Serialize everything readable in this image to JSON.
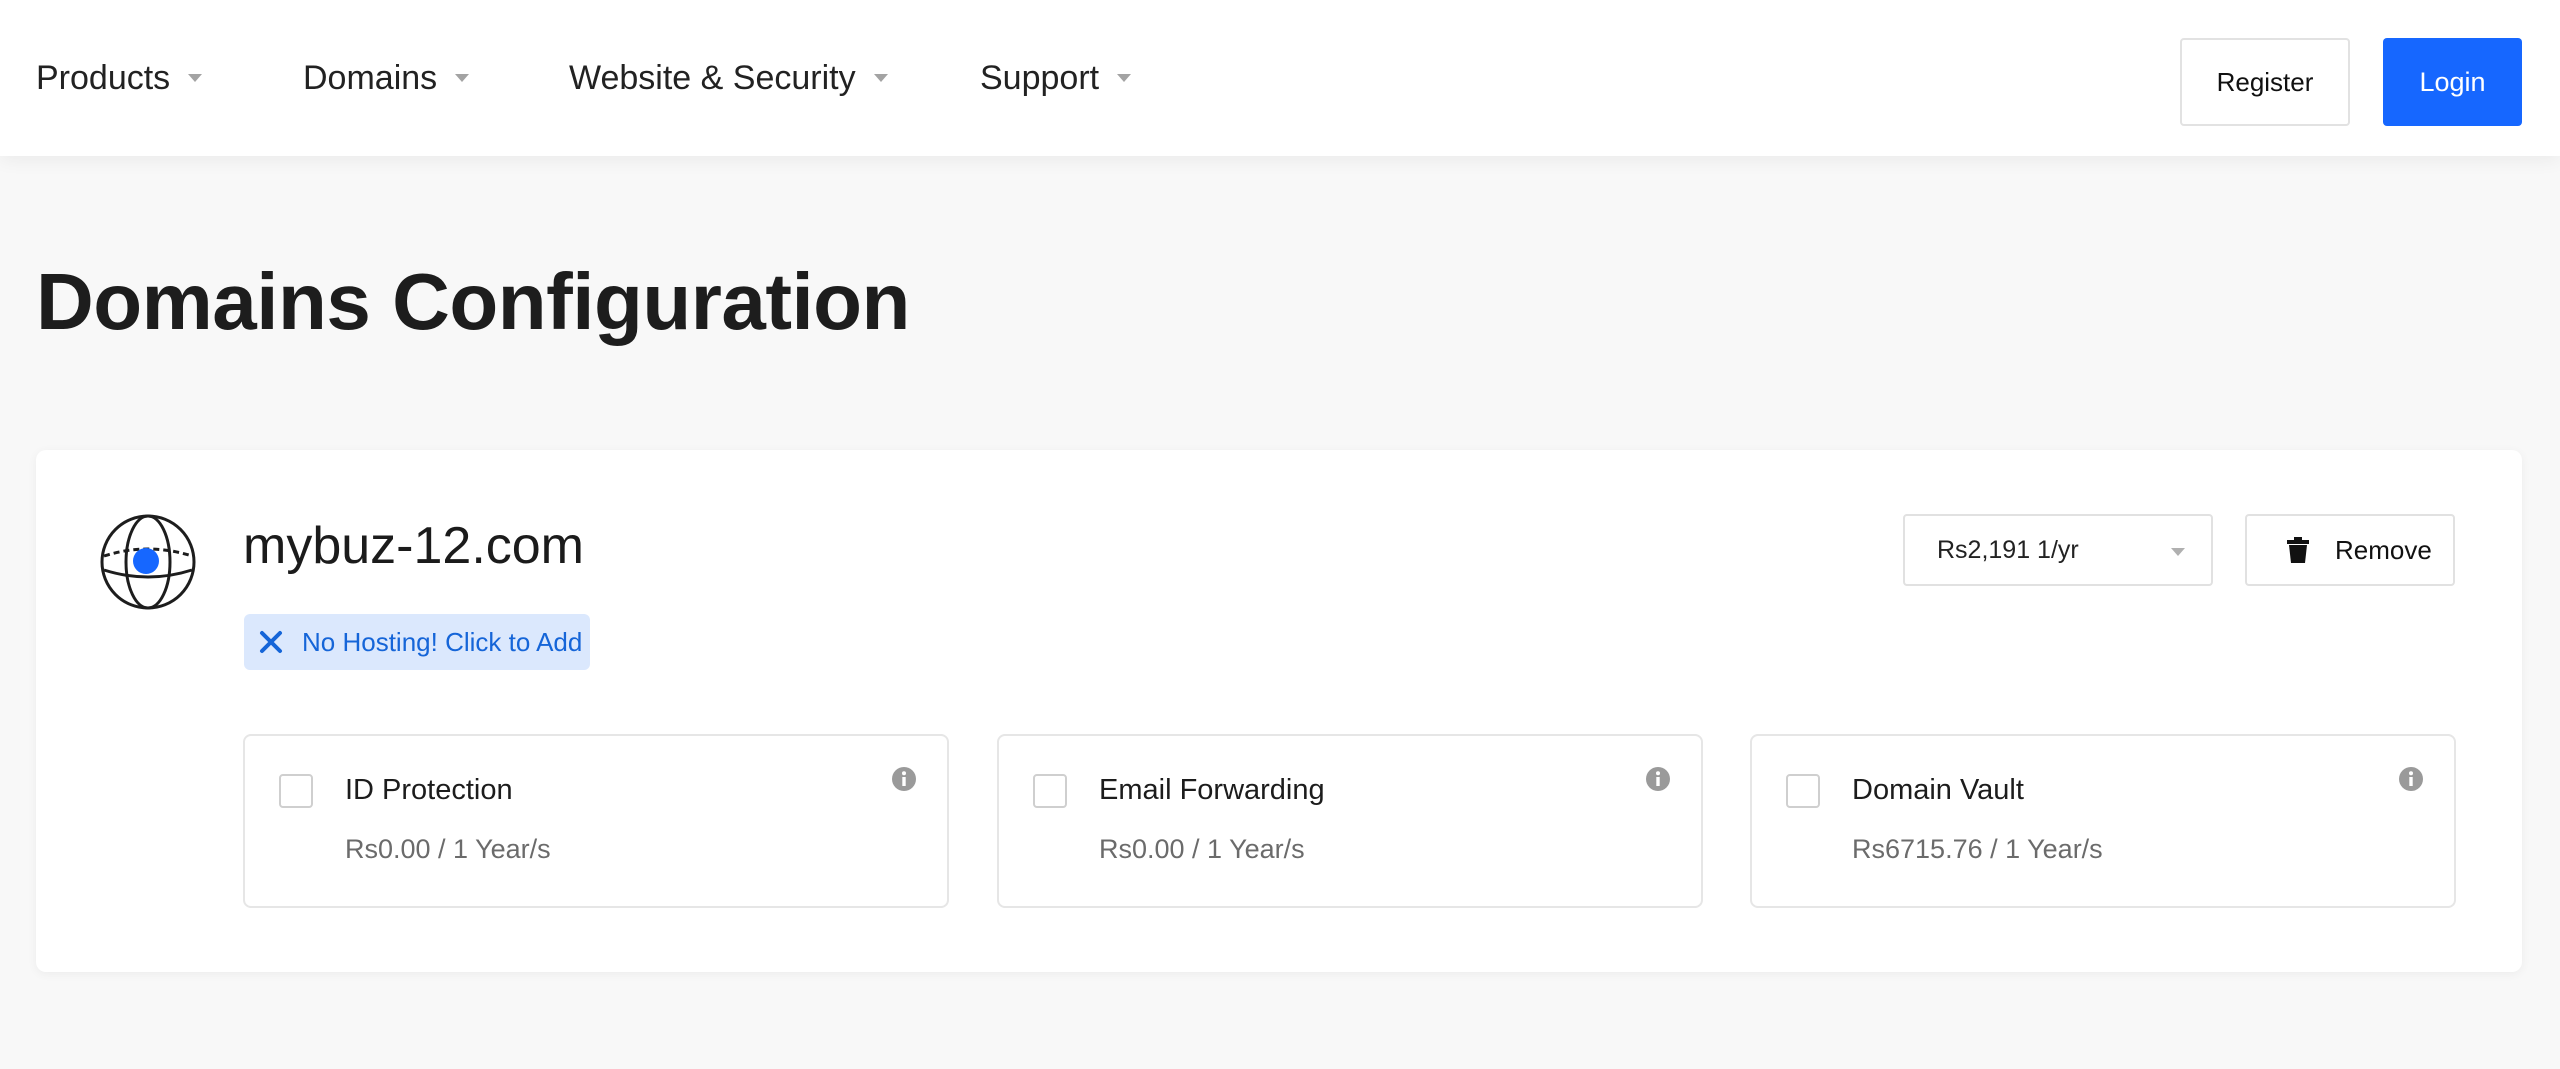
{
  "nav": {
    "items": [
      {
        "label": "Products"
      },
      {
        "label": "Domains"
      },
      {
        "label": "Website & Security"
      },
      {
        "label": "Support"
      }
    ],
    "register_label": "Register",
    "login_label": "Login"
  },
  "page": {
    "title": "Domains Configuration"
  },
  "domain": {
    "name": "mybuz-12.com",
    "hosting_badge": "No Hosting! Click to Add",
    "price_selected": "Rs2,191 1/yr",
    "remove_label": "Remove"
  },
  "addons": [
    {
      "title": "ID Protection",
      "price": "Rs0.00 / 1 Year/s"
    },
    {
      "title": "Email Forwarding",
      "price": "Rs0.00 / 1 Year/s"
    },
    {
      "title": "Domain Vault",
      "price": "Rs6715.76 / 1 Year/s"
    }
  ],
  "colors": {
    "accent": "#1667ff",
    "badge_bg": "#dbe8fd",
    "badge_text": "#1565d8"
  },
  "icons": {
    "globe": "globe-icon",
    "close": "close-icon",
    "trash": "trash-icon",
    "info": "info-icon",
    "caret": "caret-down-icon"
  }
}
